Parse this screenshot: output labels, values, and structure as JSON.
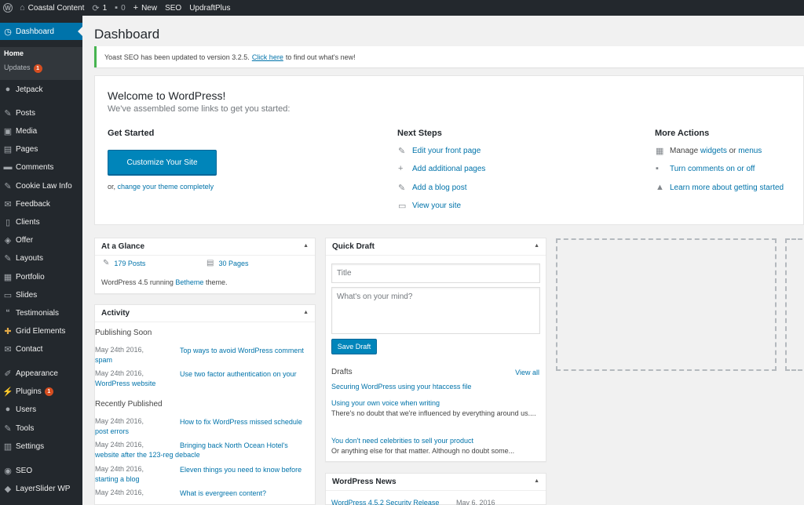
{
  "adminbar": {
    "site_name": "Coastal Content",
    "updates_count": "1",
    "comments_count": "0",
    "new_label": "New",
    "seo_label": "SEO",
    "updraft_label": "UpdraftPlus"
  },
  "sidebar": {
    "dashboard": "Dashboard",
    "home": "Home",
    "updates": "Updates",
    "updates_badge": "1",
    "items": [
      {
        "label": "Jetpack",
        "icon": "jetpack-icon"
      },
      {
        "label": "Posts",
        "icon": "pin-icon"
      },
      {
        "label": "Media",
        "icon": "media-icon"
      },
      {
        "label": "Pages",
        "icon": "pages-icon"
      },
      {
        "label": "Comments",
        "icon": "comments-icon"
      },
      {
        "label": "Cookie Law Info",
        "icon": "pin-icon"
      },
      {
        "label": "Feedback",
        "icon": "feedback-icon"
      },
      {
        "label": "Clients",
        "icon": "clients-icon"
      },
      {
        "label": "Offer",
        "icon": "offer-icon"
      },
      {
        "label": "Layouts",
        "icon": "pin-icon"
      },
      {
        "label": "Portfolio",
        "icon": "portfolio-icon"
      },
      {
        "label": "Slides",
        "icon": "slides-icon"
      },
      {
        "label": "Testimonials",
        "icon": "quote-icon"
      },
      {
        "label": "Grid Elements",
        "icon": "grid-icon"
      },
      {
        "label": "Contact",
        "icon": "mail-icon"
      },
      {
        "label": "Appearance",
        "icon": "brush-icon"
      },
      {
        "label": "Plugins",
        "icon": "plug-icon"
      },
      {
        "label": "Users",
        "icon": "users-icon"
      },
      {
        "label": "Tools",
        "icon": "wrench-icon"
      },
      {
        "label": "Settings",
        "icon": "settings-icon"
      },
      {
        "label": "SEO",
        "icon": "seo-icon"
      },
      {
        "label": "LayerSlider WP",
        "icon": "layers-icon"
      }
    ],
    "plugins_badge": "1"
  },
  "page_title": "Dashboard",
  "notice": {
    "before": "Yoast SEO has been updated to version 3.2.5.",
    "link": "Click here",
    "after": "to find out what's new!"
  },
  "welcome": {
    "title": "Welcome to WordPress!",
    "about": "We've assembled some links to get you started:",
    "get_started": "Get Started",
    "customize_button": "Customize Your Site",
    "or_text": "or,",
    "change_theme": "change your theme completely",
    "next_steps": "Next Steps",
    "next_links": [
      "Edit your front page",
      "Add additional pages",
      "Add a blog post",
      "View your site"
    ],
    "more_actions": "More Actions",
    "manage": "Manage",
    "widgets": "widgets",
    "or_word": "or",
    "menus": "menus",
    "turn_comments": "Turn comments on or off",
    "learn_more": "Learn more about getting started"
  },
  "glance": {
    "title": "At a Glance",
    "posts": "179 Posts",
    "pages": "30 Pages",
    "version_before": "WordPress 4.5 running",
    "theme": "Betheme",
    "version_after": "theme."
  },
  "activity": {
    "title": "Activity",
    "publishing_soon": "Publishing Soon",
    "soon": [
      {
        "date": "May 24th 2016,",
        "line1": "Top ways to avoid WordPress comment",
        "line2": "spam"
      },
      {
        "date": "May 24th 2016,",
        "line1": "Use two factor authentication on your",
        "line2": "WordPress website"
      }
    ],
    "recently_published": "Recently Published",
    "recent": [
      {
        "date": "May 24th 2016,",
        "line1": "How to fix WordPress missed schedule",
        "line2": "post errors"
      },
      {
        "date": "May 24th 2016,",
        "line1": "Bringing back North Ocean Hotel's",
        "line2": "website after the 123-reg debacle"
      },
      {
        "date": "May 24th 2016,",
        "line1": "Eleven things you need to know before",
        "line2": "starting a blog"
      },
      {
        "date": "May 24th 2016,",
        "line1": "What is evergreen content?",
        "line2": ""
      }
    ]
  },
  "quick_draft": {
    "title": "Quick Draft",
    "title_placeholder": "Title",
    "content_placeholder": "What's on your mind?",
    "save_button": "Save Draft",
    "drafts_label": "Drafts",
    "view_all": "View all",
    "drafts": [
      {
        "title": "Securing WordPress using your htaccess file",
        "excerpt": ""
      },
      {
        "title": "Using your own voice when writing",
        "excerpt": "There's no doubt that we're influenced by everything around us...."
      },
      {
        "title": "You don't need celebrities to sell your product",
        "excerpt": "Or anything else for that matter. Although no doubt some..."
      }
    ]
  },
  "news": {
    "title": "WordPress News",
    "item": "WordPress 4.5.2 Security Release",
    "date": "May 6, 2016"
  }
}
